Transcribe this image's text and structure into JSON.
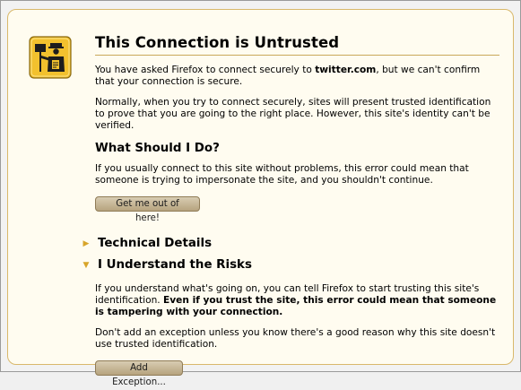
{
  "page": {
    "title": "This Connection is Untrusted",
    "intro_prefix": "You have asked Firefox to connect securely to ",
    "intro_site": "twitter.com",
    "intro_suffix": ", but we can't confirm that your connection is secure.",
    "normally": "Normally, when you try to connect securely, sites will present trusted identification to prove that you are going to the right place. However, this site's identity can't be verified."
  },
  "what_to_do": {
    "heading": "What Should I Do?",
    "body": "If you usually connect to this site without problems, this error could mean that someone is trying to impersonate the site, and you shouldn't continue.",
    "button": "Get me out of here!"
  },
  "technical": {
    "heading": "Technical Details",
    "expanded": false
  },
  "risks": {
    "heading": "I Understand the Risks",
    "expanded": true,
    "body_prefix": "If you understand what's going on, you can tell Firefox to start trusting this site's identification. ",
    "body_bold": "Even if you trust the site, this error could mean that someone is tampering with your connection.",
    "advice": "Don't add an exception unless you know there's a good reason why this site doesn't use trusted identification.",
    "button": "Add Exception..."
  },
  "icons": {
    "badge": "security-officer-icon",
    "collapsed": "triangle-right-icon",
    "expanded": "triangle-down-icon"
  },
  "colors": {
    "panel_background": "#fffcf0",
    "panel_border": "#d9b86b",
    "badge_yellow": "#f2c12e",
    "expander_arrow": "#d8a52a"
  }
}
